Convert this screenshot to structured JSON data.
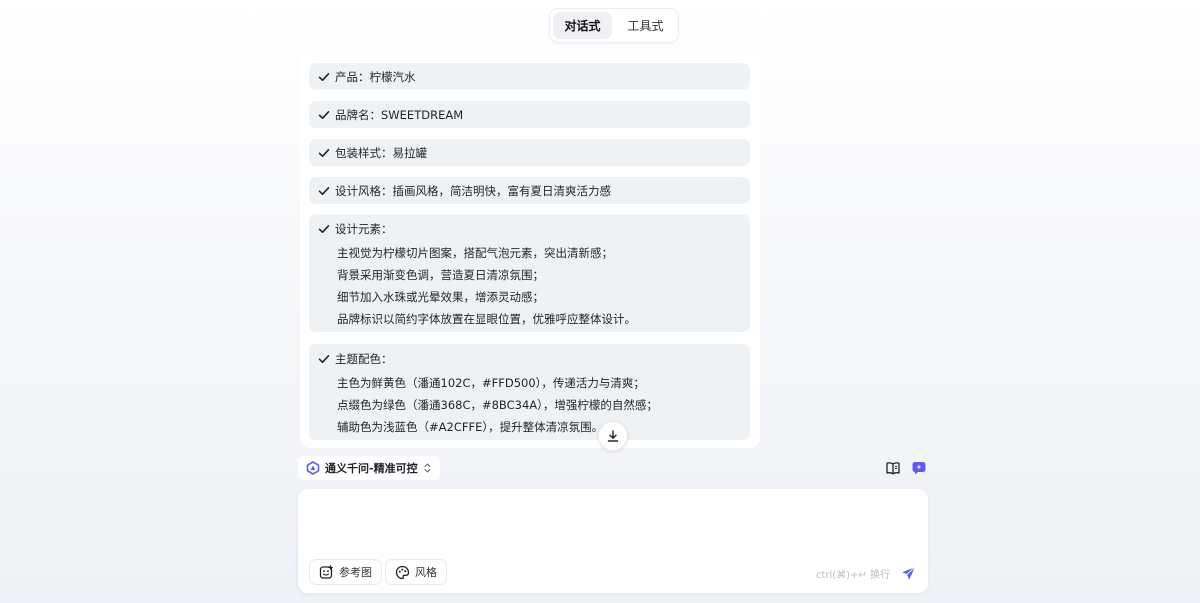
{
  "tabs": [
    {
      "label": "对话式",
      "active": true
    },
    {
      "label": "工具式",
      "active": false
    }
  ],
  "items": [
    {
      "title": "产品：柠檬汽水",
      "lines": []
    },
    {
      "title": "品牌名：SWEETDREAM",
      "lines": []
    },
    {
      "title": "包装样式：易拉罐",
      "lines": []
    },
    {
      "title": "设计风格：插画风格，简洁明快，富有夏日清爽活力感",
      "lines": []
    },
    {
      "title": "设计元素：",
      "lines": [
        "主视觉为柠檬切片图案，搭配气泡元素，突出清新感；",
        "背景采用渐变色调，营造夏日清凉氛围；",
        "细节加入水珠或光晕效果，增添灵动感；",
        "品牌标识以简约字体放置在显眼位置，优雅呼应整体设计。"
      ]
    },
    {
      "title": "主题配色：",
      "lines": [
        "主色为鲜黄色（潘通102C，#FFD500），传递活力与清爽；",
        "点缀色为绿色（潘通368C，#8BC34A），增强柠檬的自然感；",
        "辅助色为浅蓝色（#A2CFFE），提升整体清凉氛围。"
      ]
    }
  ],
  "model": {
    "label": "通义千问-精准可控"
  },
  "composer": {
    "placeholder": "",
    "chips": [
      {
        "label": "参考图",
        "icon": "image-plus-icon"
      },
      {
        "label": "风格",
        "icon": "palette-icon"
      }
    ],
    "hint": "ctrl(⌘)+↵ 换行"
  },
  "colors": {
    "accent": "#615ced",
    "item_bg": "#eff2f5"
  }
}
